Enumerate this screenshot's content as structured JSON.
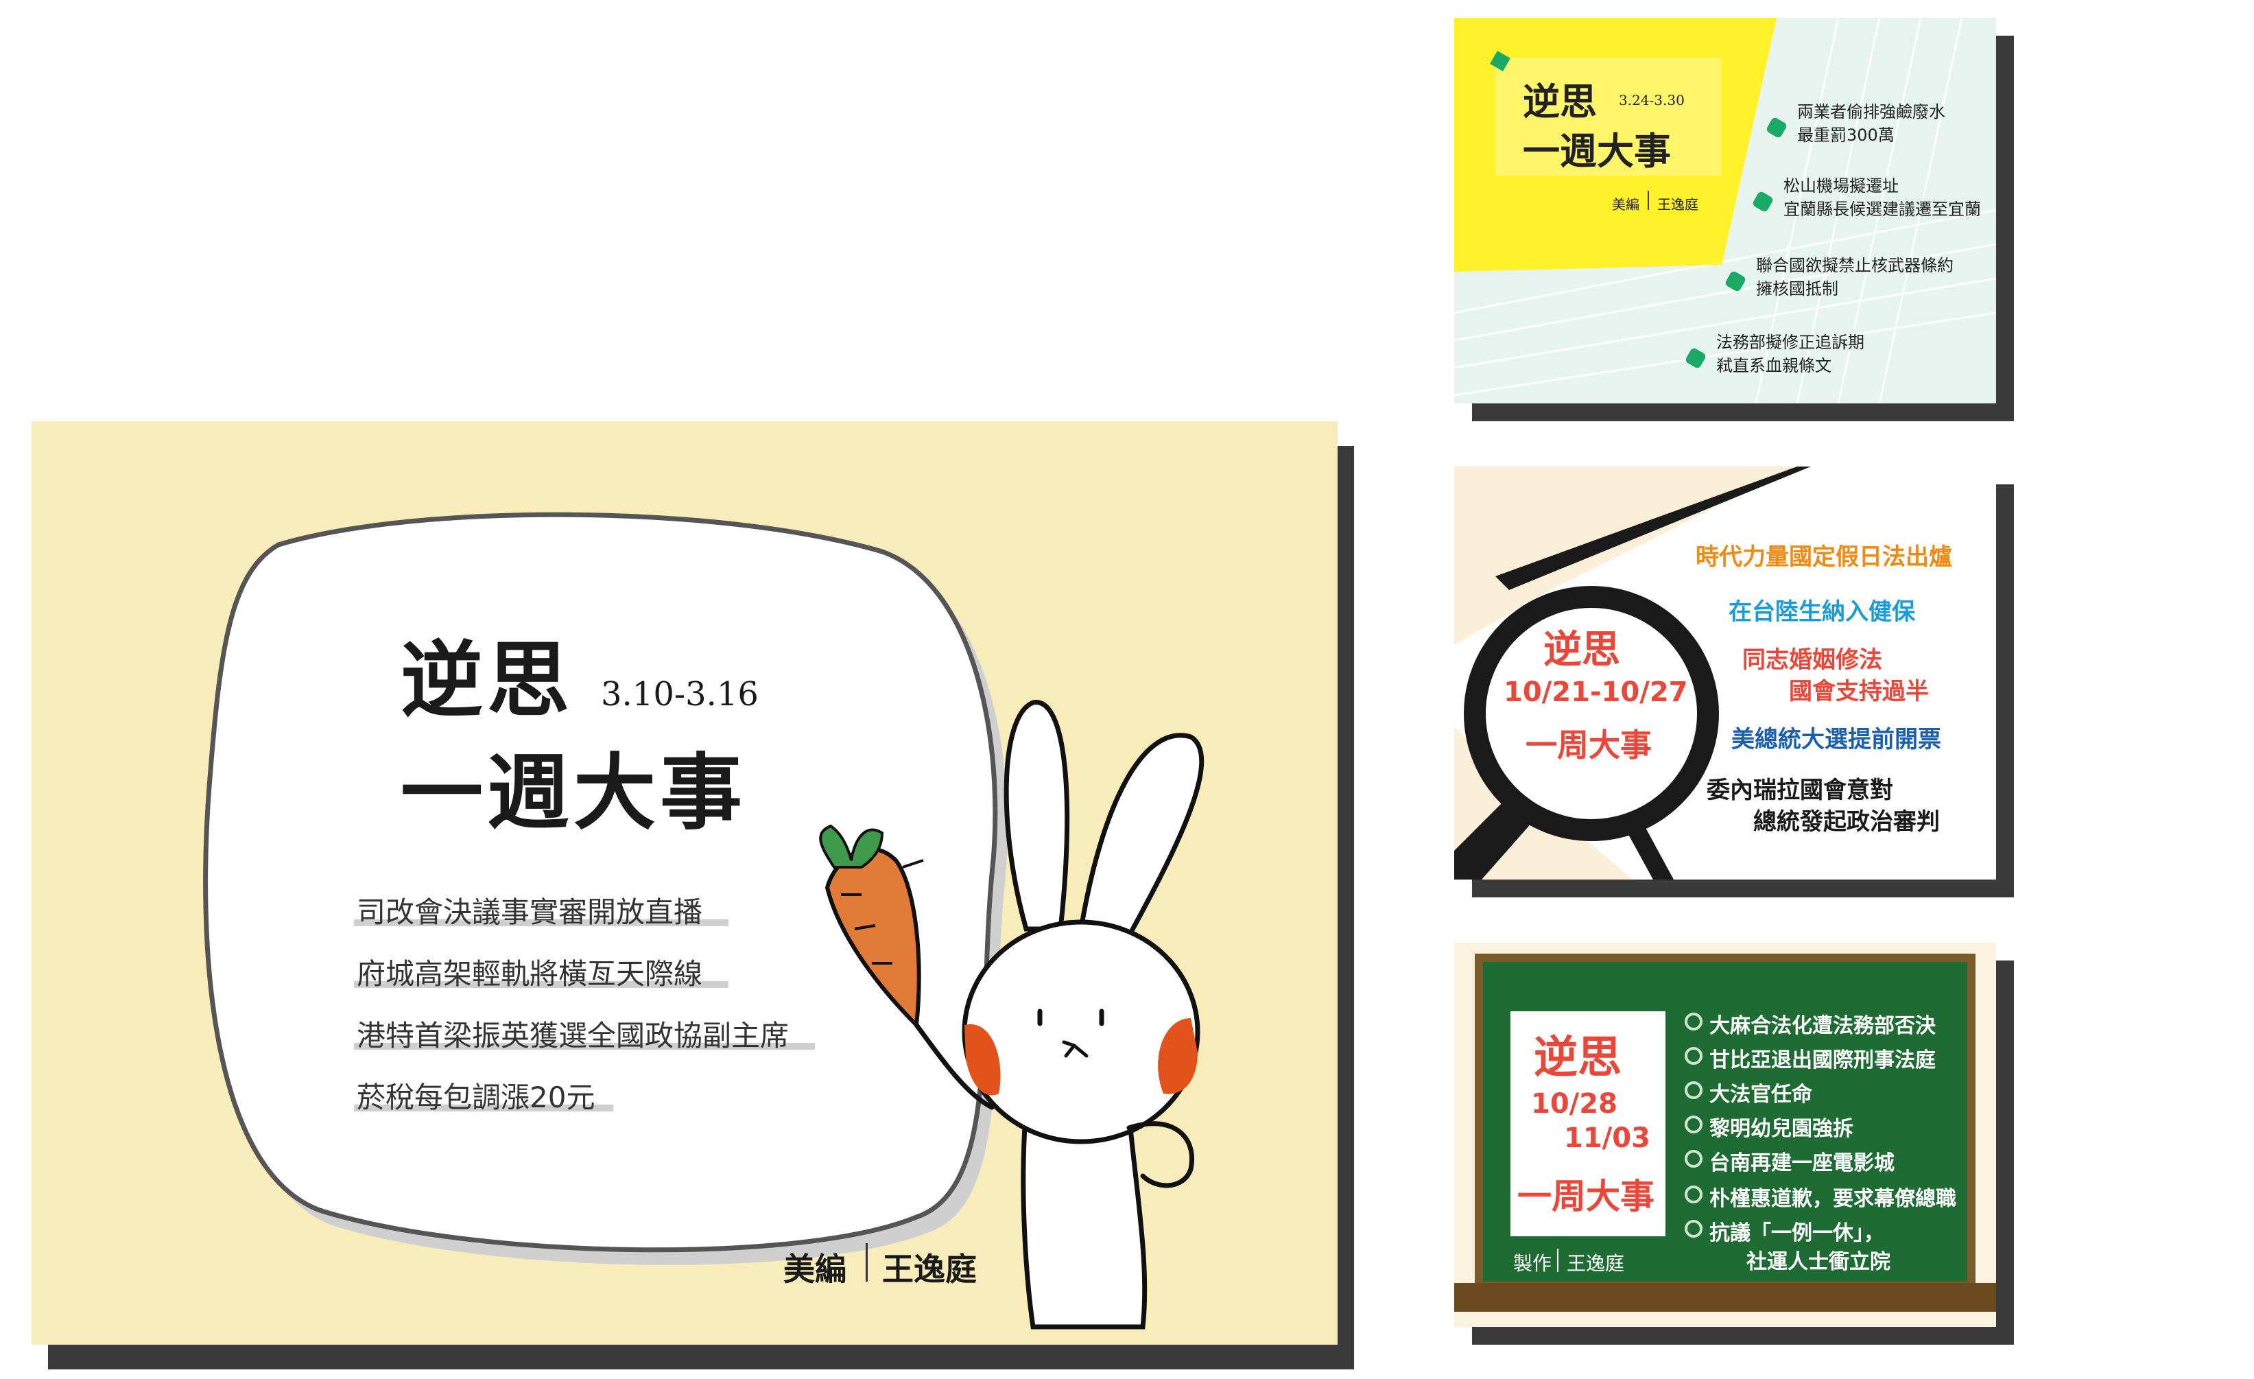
{
  "card_main": {
    "title_line1": "逆思",
    "date": "3.10-3.16",
    "title_line2": "一週大事",
    "news": [
      "司改會決議事實審開放直播",
      "府城高架輕軌將橫亙天際線",
      "港特首梁振英獲選全國政協副主席",
      "菸稅每包調漲20元"
    ],
    "credit_role": "美編",
    "credit_name": "王逸庭",
    "colors": {
      "background": "#f8edba",
      "cheek": "#e2531b",
      "carrot": "#e27a38",
      "leaf": "#3f9a4c"
    }
  },
  "card_week_2": {
    "title_line1": "逆思",
    "date": "3.24-3.30",
    "title_line2": "一週大事",
    "credit_role": "美編",
    "credit_name": "王逸庭",
    "items": [
      {
        "line1": "兩業者偷排強鹼廢水",
        "line2": "最重罰300萬"
      },
      {
        "line1": "松山機場擬遷址",
        "line2": "宜蘭縣長候選建議遷至宜蘭"
      },
      {
        "line1": "聯合國欲擬禁止核武器條約",
        "line2": "擁核國抵制"
      },
      {
        "line1": "法務部擬修正追訴期",
        "line2": "弒直系血親條文"
      }
    ],
    "colors": {
      "accent": "#fff22a",
      "dot": "#1aaa65",
      "background": "#e6f3ee"
    }
  },
  "card_week_3": {
    "title_line1": "逆思",
    "date": "10/21-10/27",
    "title_line2": "一周大事",
    "items": [
      {
        "text": "時代力量國定假日法出爐",
        "color": "#f08a14"
      },
      {
        "text": "在台陸生納入健保",
        "color": "#1a9bd7"
      },
      {
        "text": "同志婚姻修法",
        "color": "#e8473a"
      },
      {
        "text": "國會支持過半",
        "color": "#e8473a"
      },
      {
        "text": "美總統大選提前開票",
        "color": "#1b5fae"
      },
      {
        "text": "委內瑞拉國會意對",
        "color": "#1a1a1a"
      },
      {
        "text": "總統發起政治審判",
        "color": "#1a1a1a"
      }
    ],
    "colors": {
      "title": "#e8473a",
      "lens": "#1a1a1a",
      "bg": "#fbefd9"
    }
  },
  "card_week_4": {
    "title_line1": "逆思",
    "date_line1": "10/28",
    "date_line2": "11/03",
    "title_line2": "一周大事",
    "credit_role": "製作",
    "credit_name": "王逸庭",
    "items": [
      "大麻合法化遭法務部否決",
      "甘比亞退出國際刑事法庭",
      "大法官任命",
      "黎明幼兒園強拆",
      "台南再建一座電影城",
      "朴槿惠道歉，要求幕僚總職",
      "抗議「一例一休」，",
      "社運人士衝立院"
    ],
    "colors": {
      "board": "#1e6b34",
      "frame": "#7a5a2b",
      "title": "#e8473a"
    }
  }
}
